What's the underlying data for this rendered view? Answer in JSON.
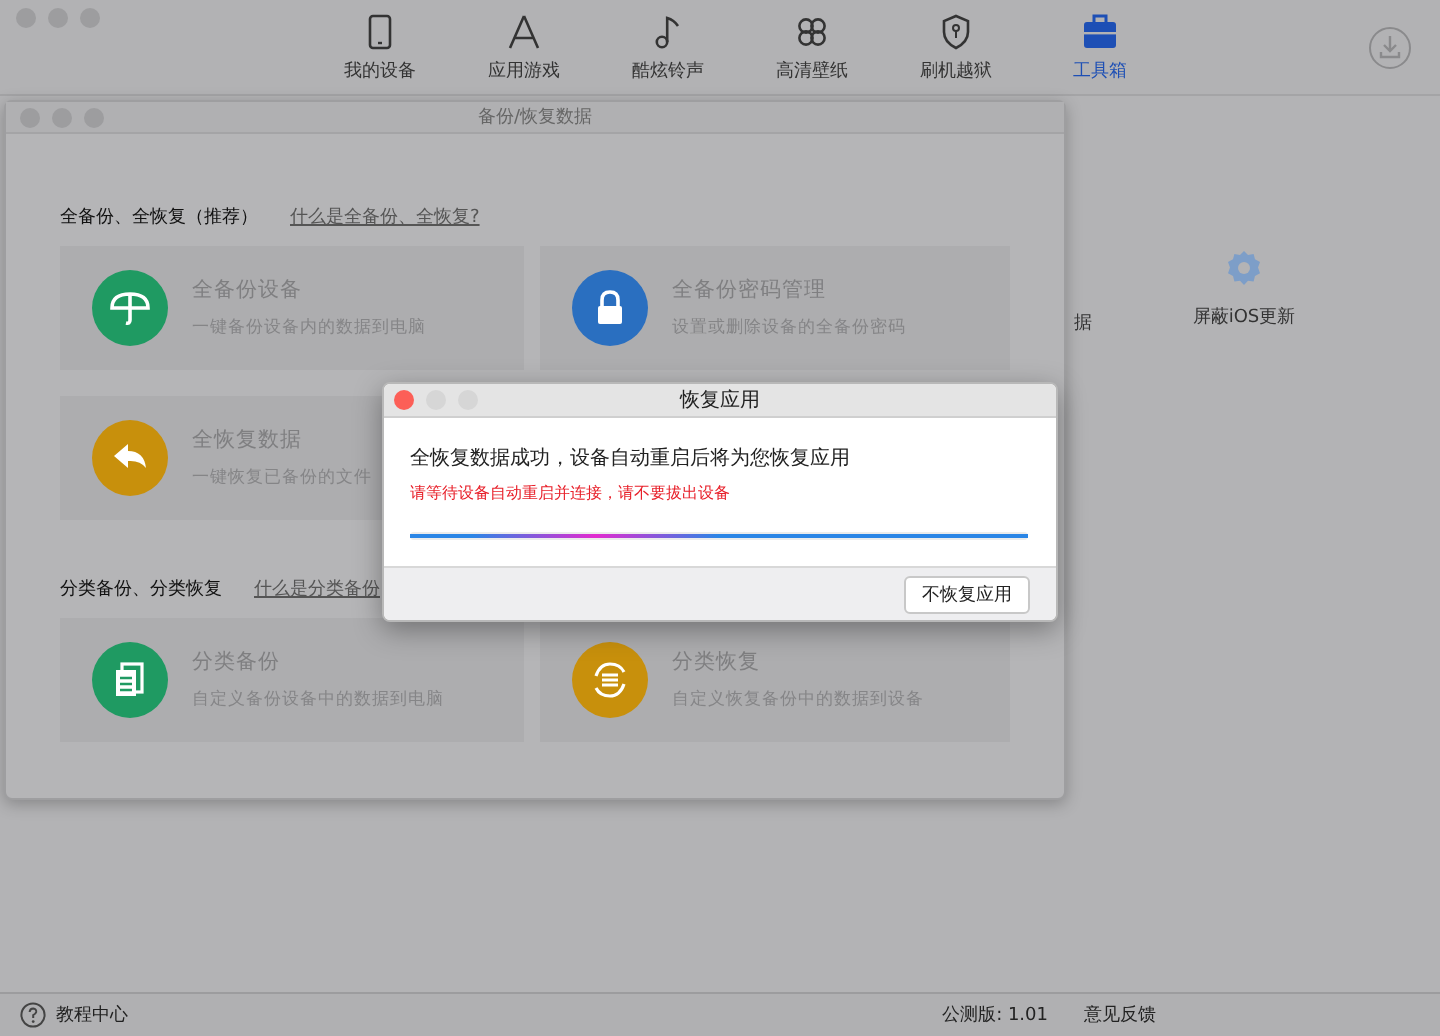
{
  "toolbar": {
    "tabs": [
      {
        "label": "我的设备",
        "selected": false
      },
      {
        "label": "应用游戏",
        "selected": false
      },
      {
        "label": "酷炫铃声",
        "selected": false
      },
      {
        "label": "高清壁纸",
        "selected": false
      },
      {
        "label": "刷机越狱",
        "selected": false
      },
      {
        "label": "工具箱",
        "selected": true
      }
    ]
  },
  "main_content": {
    "partial_label": "据",
    "tools": [
      {
        "label": "屏蔽iOS更新"
      }
    ]
  },
  "backup_window": {
    "title": "备份/恢复数据",
    "sections": [
      {
        "heading": "全备份、全恢复（推荐）",
        "link": "什么是全备份、全恢复?",
        "cards": [
          {
            "title": "全备份设备",
            "subtitle": "一键备份设备内的数据到电脑",
            "color": "#1f9a62"
          },
          {
            "title": "全备份密码管理",
            "subtitle": "设置或删除设备的全备份密码",
            "color": "#2a6fc0"
          },
          {
            "title": "全恢复数据",
            "subtitle": "一键恢复已备份的文件",
            "color": "#c8900c"
          }
        ]
      },
      {
        "heading": "分类备份、分类恢复",
        "link": "什么是分类备份",
        "cards": [
          {
            "title": "分类备份",
            "subtitle": "自定义备份设备中的数据到电脑",
            "color": "#1f9a62"
          },
          {
            "title": "分类恢复",
            "subtitle": "自定义恢复备份中的数据到设备",
            "color": "#c8900c"
          }
        ]
      }
    ]
  },
  "dialog": {
    "title": "恢复应用",
    "message": "全恢复数据成功，设备自动重启后将为您恢复应用",
    "warning": "请等待设备自动重启并连接，请不要拔出设备",
    "progress": {
      "level": 1
    },
    "buttons": [
      "不恢复应用"
    ]
  },
  "status_bar": {
    "help": "教程中心",
    "version": "公测版: 1.01",
    "feedback": "意见反馈"
  }
}
